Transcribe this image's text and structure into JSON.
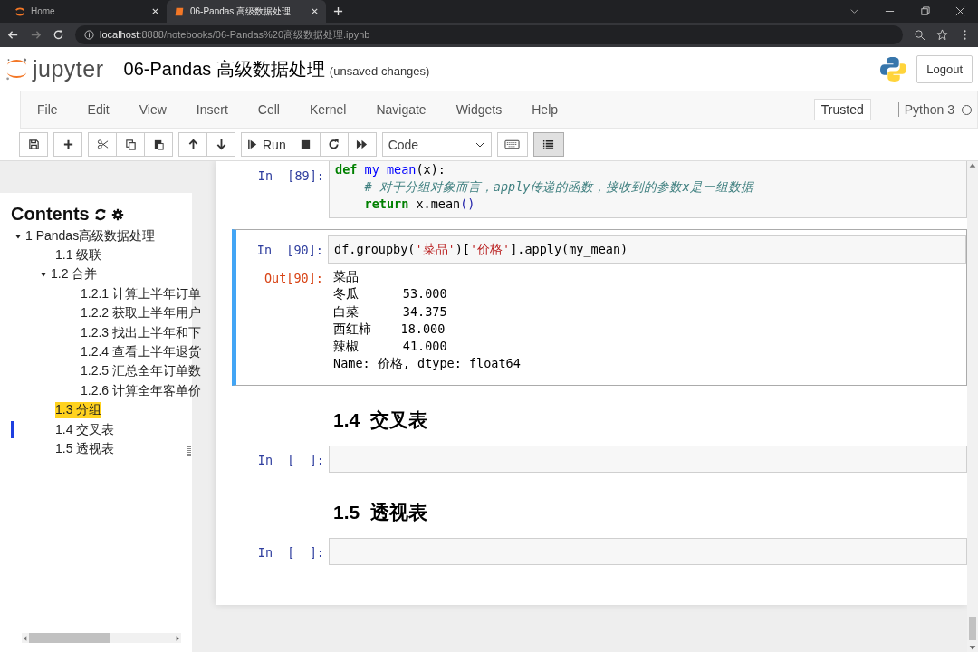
{
  "browser": {
    "tabs": [
      {
        "label": "Home",
        "selected": false
      },
      {
        "label": "06-Pandas 高级数据处理",
        "selected": true
      }
    ],
    "address": {
      "host": "localhost",
      "path": ":8888/notebooks/06-Pandas%20高级数据处理.ipynb"
    }
  },
  "header": {
    "logo": "jupyter",
    "title": "06-Pandas 高级数据处理",
    "status": "(unsaved changes)",
    "logout": "Logout"
  },
  "menubar": {
    "items": [
      "File",
      "Edit",
      "View",
      "Insert",
      "Cell",
      "Kernel",
      "Navigate",
      "Widgets",
      "Help"
    ],
    "trusted": "Trusted",
    "kernel": "Python 3",
    "kernel_busy": false
  },
  "toolbar": {
    "run": "Run",
    "cell_type": "Code",
    "toc_active": true
  },
  "toc": {
    "title": "Contents",
    "items": [
      {
        "label": "1  Pandas高级数据处理",
        "expanded": true,
        "highlighted": false,
        "current": false,
        "children": [
          {
            "label": "1.1  级联",
            "highlighted": false,
            "current": false
          },
          {
            "label": "1.2  合并",
            "expanded": true,
            "highlighted": false,
            "current": false,
            "children": [
              {
                "label": "1.2.1  计算上半年订单",
                "highlighted": false,
                "current": false
              },
              {
                "label": "1.2.2  获取上半年用户",
                "highlighted": false,
                "current": false
              },
              {
                "label": "1.2.3  找出上半年和下",
                "highlighted": false,
                "current": false
              },
              {
                "label": "1.2.4  查看上半年退货",
                "highlighted": false,
                "current": false
              },
              {
                "label": "1.2.5  汇总全年订单数",
                "highlighted": false,
                "current": false
              },
              {
                "label": "1.2.6  计算全年客单价",
                "highlighted": false,
                "current": false
              }
            ]
          },
          {
            "label": "1.3  分组",
            "highlighted": true,
            "current": false
          },
          {
            "label": "1.4  交叉表",
            "highlighted": false,
            "current": true
          },
          {
            "label": "1.5  透视表",
            "highlighted": false,
            "current": false
          }
        ]
      }
    ]
  },
  "cells": [
    {
      "kind": "code",
      "selected": false,
      "prompt": "In  [89]:",
      "lines": [
        {
          "indented": false,
          "tokens": [
            {
              "kind": "keyword",
              "text": "def "
            },
            {
              "kind": "name",
              "text": "my_mean"
            },
            {
              "kind": "plain",
              "text": "(x):"
            }
          ]
        },
        {
          "indented": true,
          "tokens": [
            {
              "kind": "comment",
              "text": "# 对于分组对象而言，apply传递的函数，接收到的参数x是一组数据"
            }
          ]
        },
        {
          "indented": true,
          "tokens": [
            {
              "kind": "keyword",
              "text": "return"
            },
            {
              "kind": "plain",
              "text": " x.mean"
            },
            {
              "kind": "paren",
              "text": "()"
            }
          ]
        }
      ]
    },
    {
      "kind": "code",
      "selected": true,
      "prompt": "In  [90]:",
      "lines": [
        {
          "indented": false,
          "tokens": [
            {
              "kind": "plain",
              "text": "df.groupby("
            },
            {
              "kind": "string",
              "text": "'菜品'"
            },
            {
              "kind": "plain",
              "text": ")["
            },
            {
              "kind": "string",
              "text": "'价格'"
            },
            {
              "kind": "plain",
              "text": "].apply(my_mean)"
            }
          ]
        }
      ],
      "output_prompt": "Out[90]:",
      "output": [
        "菜品",
        "冬瓜      53.000",
        "白菜      34.375",
        "西红柿    18.000",
        "辣椒      41.000",
        "Name: 价格, dtype: float64"
      ]
    },
    {
      "kind": "heading",
      "number": "1.4",
      "text": "交叉表"
    },
    {
      "kind": "code",
      "selected": false,
      "prompt": "In  [  ]:"
    },
    {
      "kind": "heading",
      "number": "1.5",
      "text": "透视表"
    },
    {
      "kind": "code",
      "selected": false,
      "prompt": "In  [  ]:"
    }
  ]
}
